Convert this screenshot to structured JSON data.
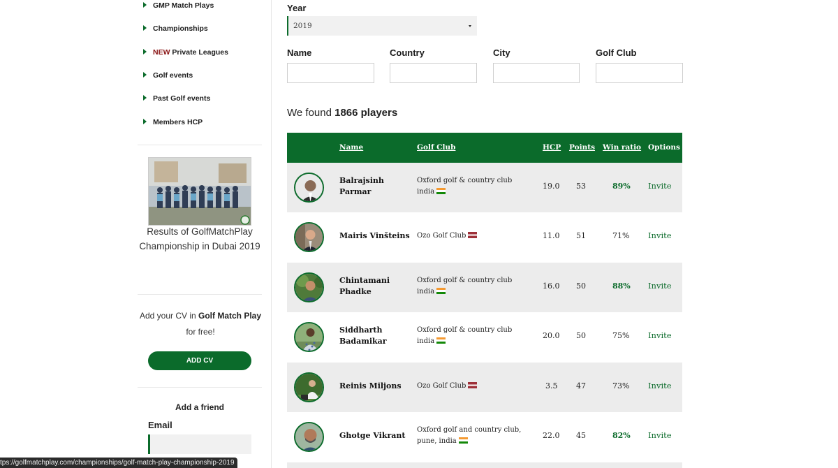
{
  "sidebar": {
    "menu": [
      {
        "label": "GMP Match Plays",
        "new": ""
      },
      {
        "label": "Championships",
        "new": ""
      },
      {
        "label": " Private Leagues",
        "new": "NEW"
      },
      {
        "label": "Golf events",
        "new": ""
      },
      {
        "label": "Past Golf events",
        "new": ""
      },
      {
        "label": "Members HCP",
        "new": ""
      }
    ],
    "promo_caption": "Results of GolfMatchPlay Championship in Dubai 2019",
    "cv_text_1": "Add your CV in ",
    "cv_text_bold": "Golf Match Play",
    "cv_text_2": " for free!",
    "add_cv_label": "ADD CV",
    "friend_title": "Add a friend",
    "email_label": "Email"
  },
  "status_url": "tps://golfmatchplay.com/championships/golf-match-play-championship-2019",
  "filters": {
    "year_label": "Year",
    "year_value": "2019",
    "name_label": "Name",
    "country_label": "Country",
    "city_label": "City",
    "club_label": "Golf Club"
  },
  "results": {
    "prefix": "We found ",
    "count": "1866 players"
  },
  "table": {
    "headers": {
      "name": "Name",
      "club": "Golf Club",
      "hcp": "HCP",
      "points": "Points",
      "win": "Win ratio",
      "options": "Options"
    },
    "rows": [
      {
        "name": "Balrajsinh Parmar",
        "club": "Oxford golf & country club india",
        "flag": "india",
        "hcp": "19.0",
        "points": "53",
        "win": "89%",
        "win_highlight": true,
        "action": "Invite"
      },
      {
        "name": "Mairis Vinšteins",
        "club": "Ozo Golf Club",
        "flag": "latvia",
        "hcp": "11.0",
        "points": "51",
        "win": "71%",
        "win_highlight": false,
        "action": "Invite"
      },
      {
        "name": "Chintamani Phadke",
        "club": "Oxford golf & country club india",
        "flag": "india",
        "hcp": "16.0",
        "points": "50",
        "win": "88%",
        "win_highlight": true,
        "action": "Invite"
      },
      {
        "name": "Siddharth Badamikar",
        "club": "Oxford golf & country club india",
        "flag": "india",
        "hcp": "20.0",
        "points": "50",
        "win": "75%",
        "win_highlight": false,
        "action": "Invite"
      },
      {
        "name": "Reinis Miljons",
        "club": "Ozo Golf Club",
        "flag": "latvia",
        "hcp": "3.5",
        "points": "47",
        "win": "73%",
        "win_highlight": false,
        "action": "Invite"
      },
      {
        "name": "Ghotge Vikrant",
        "club": "Oxford golf and country club, pune, india",
        "flag": "india",
        "hcp": "22.0",
        "points": "45",
        "win": "82%",
        "win_highlight": true,
        "action": "Invite"
      }
    ]
  },
  "colors": {
    "brand_green": "#0b6b2b",
    "row_gray": "#ececec"
  }
}
